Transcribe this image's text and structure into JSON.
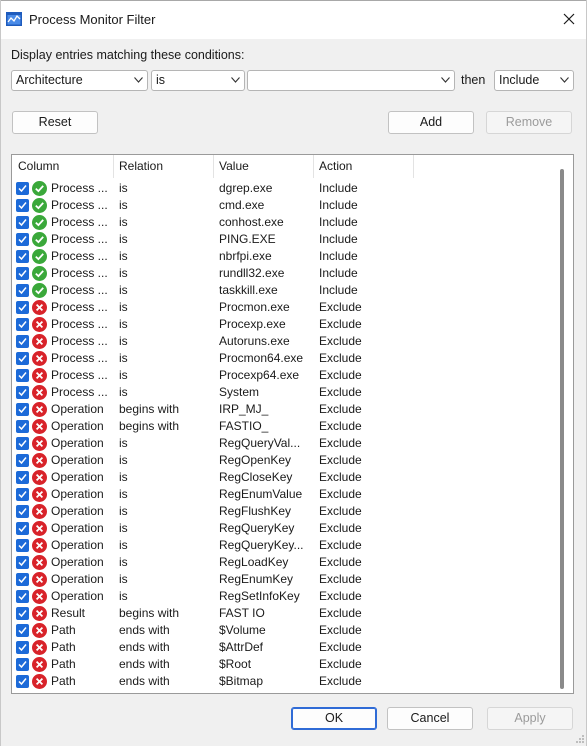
{
  "window": {
    "title": "Process Monitor Filter",
    "icon": "procmon-icon"
  },
  "caption": "Display entries matching these conditions:",
  "condition": {
    "column": "Architecture",
    "relation": "is",
    "value": "",
    "then_label": "then",
    "action": "Include"
  },
  "buttons": {
    "reset": "Reset",
    "add": "Add",
    "remove": "Remove",
    "ok": "OK",
    "cancel": "Cancel",
    "apply": "Apply"
  },
  "columns": [
    "Column",
    "Relation",
    "Value",
    "Action"
  ],
  "colors": {
    "include": "#3aa83a",
    "exclude": "#d8232a",
    "checkbox": "#1c6ad8",
    "accent": "#2f6bd6"
  },
  "rows": [
    {
      "column": "Process ...",
      "relation": "is",
      "value": "dgrep.exe",
      "action": "Include"
    },
    {
      "column": "Process ...",
      "relation": "is",
      "value": "cmd.exe",
      "action": "Include"
    },
    {
      "column": "Process ...",
      "relation": "is",
      "value": "conhost.exe",
      "action": "Include"
    },
    {
      "column": "Process ...",
      "relation": "is",
      "value": "PING.EXE",
      "action": "Include"
    },
    {
      "column": "Process ...",
      "relation": "is",
      "value": "nbrfpi.exe",
      "action": "Include"
    },
    {
      "column": "Process ...",
      "relation": "is",
      "value": "rundll32.exe",
      "action": "Include"
    },
    {
      "column": "Process ...",
      "relation": "is",
      "value": "taskkill.exe",
      "action": "Include"
    },
    {
      "column": "Process ...",
      "relation": "is",
      "value": "Procmon.exe",
      "action": "Exclude"
    },
    {
      "column": "Process ...",
      "relation": "is",
      "value": "Procexp.exe",
      "action": "Exclude"
    },
    {
      "column": "Process ...",
      "relation": "is",
      "value": "Autoruns.exe",
      "action": "Exclude"
    },
    {
      "column": "Process ...",
      "relation": "is",
      "value": "Procmon64.exe",
      "action": "Exclude"
    },
    {
      "column": "Process ...",
      "relation": "is",
      "value": "Procexp64.exe",
      "action": "Exclude"
    },
    {
      "column": "Process ...",
      "relation": "is",
      "value": "System",
      "action": "Exclude"
    },
    {
      "column": "Operation",
      "relation": "begins with",
      "value": "IRP_MJ_",
      "action": "Exclude"
    },
    {
      "column": "Operation",
      "relation": "begins with",
      "value": "FASTIO_",
      "action": "Exclude"
    },
    {
      "column": "Operation",
      "relation": "is",
      "value": "RegQueryVal...",
      "action": "Exclude"
    },
    {
      "column": "Operation",
      "relation": "is",
      "value": "RegOpenKey",
      "action": "Exclude"
    },
    {
      "column": "Operation",
      "relation": "is",
      "value": "RegCloseKey",
      "action": "Exclude"
    },
    {
      "column": "Operation",
      "relation": "is",
      "value": "RegEnumValue",
      "action": "Exclude"
    },
    {
      "column": "Operation",
      "relation": "is",
      "value": "RegFlushKey",
      "action": "Exclude"
    },
    {
      "column": "Operation",
      "relation": "is",
      "value": "RegQueryKey",
      "action": "Exclude"
    },
    {
      "column": "Operation",
      "relation": "is",
      "value": "RegQueryKey...",
      "action": "Exclude"
    },
    {
      "column": "Operation",
      "relation": "is",
      "value": "RegLoadKey",
      "action": "Exclude"
    },
    {
      "column": "Operation",
      "relation": "is",
      "value": "RegEnumKey",
      "action": "Exclude"
    },
    {
      "column": "Operation",
      "relation": "is",
      "value": "RegSetInfoKey",
      "action": "Exclude"
    },
    {
      "column": "Result",
      "relation": "begins with",
      "value": "FAST IO",
      "action": "Exclude"
    },
    {
      "column": "Path",
      "relation": "ends with",
      "value": "$Volume",
      "action": "Exclude"
    },
    {
      "column": "Path",
      "relation": "ends with",
      "value": "$AttrDef",
      "action": "Exclude"
    },
    {
      "column": "Path",
      "relation": "ends with",
      "value": "$Root",
      "action": "Exclude"
    },
    {
      "column": "Path",
      "relation": "ends with",
      "value": "$Bitmap",
      "action": "Exclude"
    }
  ]
}
